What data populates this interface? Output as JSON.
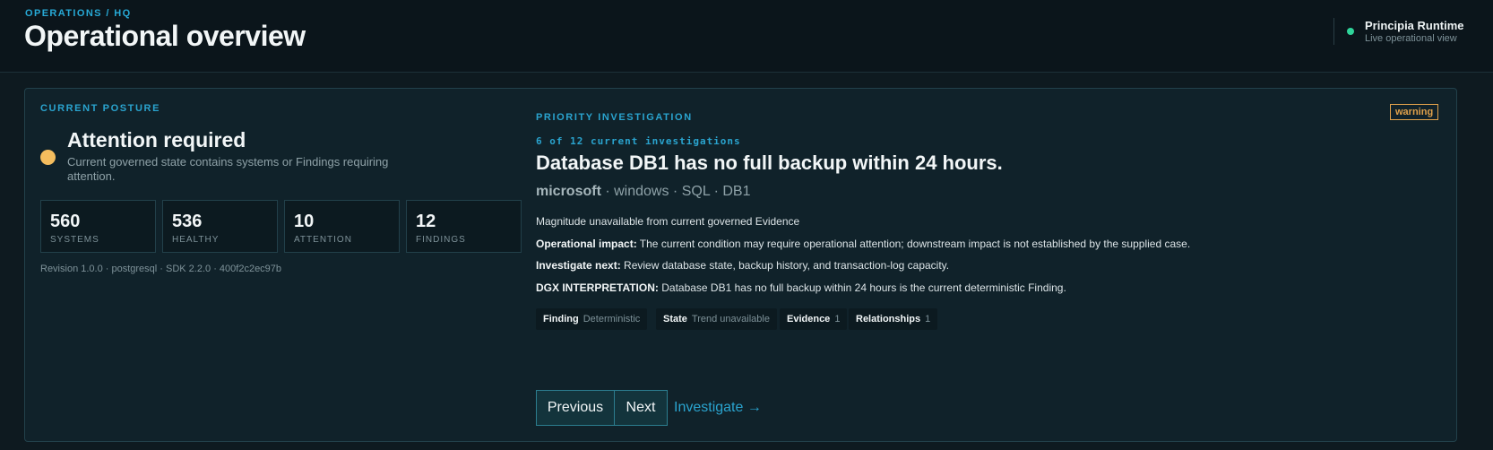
{
  "header": {
    "breadcrumb": "OPERATIONS / HQ",
    "title": "Operational overview",
    "runtime_name": "Principia Runtime",
    "runtime_status": "Live operational view"
  },
  "posture": {
    "section_label": "CURRENT POSTURE",
    "title": "Attention required",
    "description": "Current governed state contains systems or Findings requiring attention.",
    "stats": [
      {
        "value": "560",
        "label": "SYSTEMS"
      },
      {
        "value": "536",
        "label": "HEALTHY"
      },
      {
        "value": "10",
        "label": "ATTENTION"
      },
      {
        "value": "12",
        "label": "FINDINGS"
      }
    ],
    "revision": "Revision 1.0.0 · postgresql · SDK 2.2.0 · 400f2c2ec97b"
  },
  "investigation": {
    "section_label": "PRIORITY INVESTIGATION",
    "badge": "warning",
    "count": "6 of 12 current investigations",
    "title": "Database DB1 has no full backup within 24 hours.",
    "source_vendor": "microsoft",
    "source_rest": " · windows · SQL · DB1",
    "magnitude": "Magnitude unavailable from current governed Evidence",
    "impact_label": "Operational impact:",
    "impact_text": " The current condition may require operational attention; downstream impact is not established by the supplied case.",
    "next_label": "Investigate next:",
    "next_text": " Review database state, backup history, and transaction-log capacity.",
    "dgx_label": "DGX INTERPRETATION:",
    "dgx_text": " Database DB1 has no full backup within 24 hours is the current deterministic Finding.",
    "chips": [
      {
        "key": "Finding",
        "value": "Deterministic"
      },
      {
        "key": "State",
        "value": "Trend unavailable"
      },
      {
        "key": "Evidence",
        "value": "1"
      },
      {
        "key": "Relationships",
        "value": "1"
      }
    ],
    "previous_label": "Previous",
    "next_label_btn": "Next",
    "investigate_link": "Investigate →"
  },
  "colors": {
    "accent": "#2aa4cf",
    "warning": "#e0a14b",
    "attention_dot": "#f4bd5e",
    "live_dot": "#2fd49a"
  }
}
